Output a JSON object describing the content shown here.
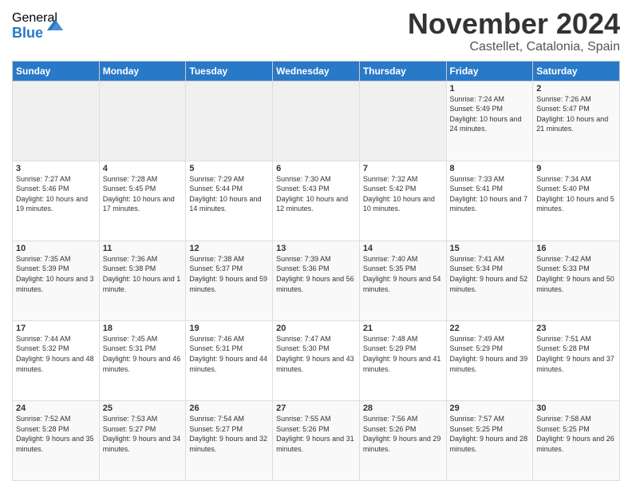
{
  "logo": {
    "general": "General",
    "blue": "Blue"
  },
  "title": "November 2024",
  "location": "Castellet, Catalonia, Spain",
  "headers": [
    "Sunday",
    "Monday",
    "Tuesday",
    "Wednesday",
    "Thursday",
    "Friday",
    "Saturday"
  ],
  "weeks": [
    [
      {
        "day": "",
        "info": ""
      },
      {
        "day": "",
        "info": ""
      },
      {
        "day": "",
        "info": ""
      },
      {
        "day": "",
        "info": ""
      },
      {
        "day": "",
        "info": ""
      },
      {
        "day": "1",
        "info": "Sunrise: 7:24 AM\nSunset: 5:49 PM\nDaylight: 10 hours and 24 minutes."
      },
      {
        "day": "2",
        "info": "Sunrise: 7:26 AM\nSunset: 5:47 PM\nDaylight: 10 hours and 21 minutes."
      }
    ],
    [
      {
        "day": "3",
        "info": "Sunrise: 7:27 AM\nSunset: 5:46 PM\nDaylight: 10 hours and 19 minutes."
      },
      {
        "day": "4",
        "info": "Sunrise: 7:28 AM\nSunset: 5:45 PM\nDaylight: 10 hours and 17 minutes."
      },
      {
        "day": "5",
        "info": "Sunrise: 7:29 AM\nSunset: 5:44 PM\nDaylight: 10 hours and 14 minutes."
      },
      {
        "day": "6",
        "info": "Sunrise: 7:30 AM\nSunset: 5:43 PM\nDaylight: 10 hours and 12 minutes."
      },
      {
        "day": "7",
        "info": "Sunrise: 7:32 AM\nSunset: 5:42 PM\nDaylight: 10 hours and 10 minutes."
      },
      {
        "day": "8",
        "info": "Sunrise: 7:33 AM\nSunset: 5:41 PM\nDaylight: 10 hours and 7 minutes."
      },
      {
        "day": "9",
        "info": "Sunrise: 7:34 AM\nSunset: 5:40 PM\nDaylight: 10 hours and 5 minutes."
      }
    ],
    [
      {
        "day": "10",
        "info": "Sunrise: 7:35 AM\nSunset: 5:39 PM\nDaylight: 10 hours and 3 minutes."
      },
      {
        "day": "11",
        "info": "Sunrise: 7:36 AM\nSunset: 5:38 PM\nDaylight: 10 hours and 1 minute."
      },
      {
        "day": "12",
        "info": "Sunrise: 7:38 AM\nSunset: 5:37 PM\nDaylight: 9 hours and 59 minutes."
      },
      {
        "day": "13",
        "info": "Sunrise: 7:39 AM\nSunset: 5:36 PM\nDaylight: 9 hours and 56 minutes."
      },
      {
        "day": "14",
        "info": "Sunrise: 7:40 AM\nSunset: 5:35 PM\nDaylight: 9 hours and 54 minutes."
      },
      {
        "day": "15",
        "info": "Sunrise: 7:41 AM\nSunset: 5:34 PM\nDaylight: 9 hours and 52 minutes."
      },
      {
        "day": "16",
        "info": "Sunrise: 7:42 AM\nSunset: 5:33 PM\nDaylight: 9 hours and 50 minutes."
      }
    ],
    [
      {
        "day": "17",
        "info": "Sunrise: 7:44 AM\nSunset: 5:32 PM\nDaylight: 9 hours and 48 minutes."
      },
      {
        "day": "18",
        "info": "Sunrise: 7:45 AM\nSunset: 5:31 PM\nDaylight: 9 hours and 46 minutes."
      },
      {
        "day": "19",
        "info": "Sunrise: 7:46 AM\nSunset: 5:31 PM\nDaylight: 9 hours and 44 minutes."
      },
      {
        "day": "20",
        "info": "Sunrise: 7:47 AM\nSunset: 5:30 PM\nDaylight: 9 hours and 43 minutes."
      },
      {
        "day": "21",
        "info": "Sunrise: 7:48 AM\nSunset: 5:29 PM\nDaylight: 9 hours and 41 minutes."
      },
      {
        "day": "22",
        "info": "Sunrise: 7:49 AM\nSunset: 5:29 PM\nDaylight: 9 hours and 39 minutes."
      },
      {
        "day": "23",
        "info": "Sunrise: 7:51 AM\nSunset: 5:28 PM\nDaylight: 9 hours and 37 minutes."
      }
    ],
    [
      {
        "day": "24",
        "info": "Sunrise: 7:52 AM\nSunset: 5:28 PM\nDaylight: 9 hours and 35 minutes."
      },
      {
        "day": "25",
        "info": "Sunrise: 7:53 AM\nSunset: 5:27 PM\nDaylight: 9 hours and 34 minutes."
      },
      {
        "day": "26",
        "info": "Sunrise: 7:54 AM\nSunset: 5:27 PM\nDaylight: 9 hours and 32 minutes."
      },
      {
        "day": "27",
        "info": "Sunrise: 7:55 AM\nSunset: 5:26 PM\nDaylight: 9 hours and 31 minutes."
      },
      {
        "day": "28",
        "info": "Sunrise: 7:56 AM\nSunset: 5:26 PM\nDaylight: 9 hours and 29 minutes."
      },
      {
        "day": "29",
        "info": "Sunrise: 7:57 AM\nSunset: 5:25 PM\nDaylight: 9 hours and 28 minutes."
      },
      {
        "day": "30",
        "info": "Sunrise: 7:58 AM\nSunset: 5:25 PM\nDaylight: 9 hours and 26 minutes."
      }
    ]
  ]
}
